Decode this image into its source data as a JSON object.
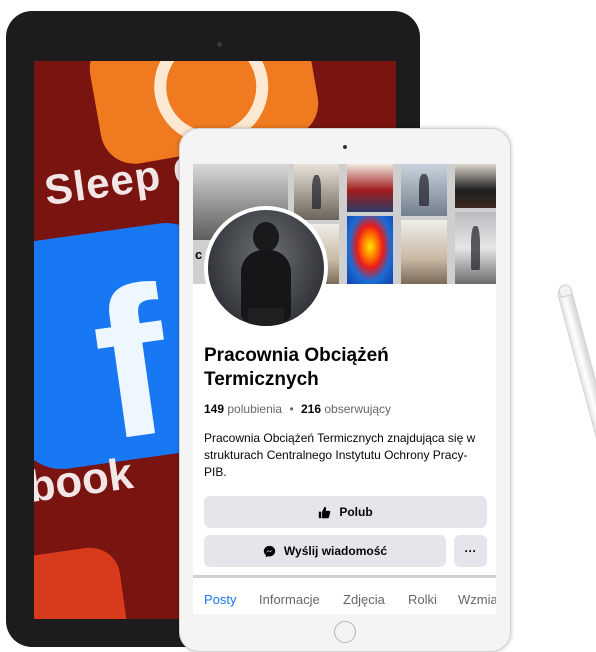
{
  "background_apps": {
    "sleep_label": "Sleep C",
    "fb_glyph": "f",
    "book_label": "book"
  },
  "page": {
    "cover_letter": "c",
    "name": "Pracownia Obciążeń Termicznych",
    "likes_count": "149",
    "likes_label": "polubienia",
    "separator": "•",
    "followers_count": "216",
    "followers_label": "obserwujący",
    "description": "Pracownia Obciążeń Termicznych znajdująca się w strukturach Centralnego Instytutu Ochrony Pracy-PIB."
  },
  "actions": {
    "like_label": "Polub",
    "message_label": "Wyślij wiadomość",
    "more_label": "···"
  },
  "tabs": [
    {
      "label": "Posty"
    },
    {
      "label": "Informacje"
    },
    {
      "label": "Zdjęcia"
    },
    {
      "label": "Rolki"
    },
    {
      "label": "Wzmia"
    }
  ],
  "colors": {
    "accent": "#1877f2",
    "button_bg": "#e4e6eb",
    "muted_text": "#65676b"
  },
  "icons": [
    "thumbs-up-icon",
    "messenger-icon",
    "more-icon",
    "facebook-logo-icon",
    "clock-app-icon"
  ]
}
